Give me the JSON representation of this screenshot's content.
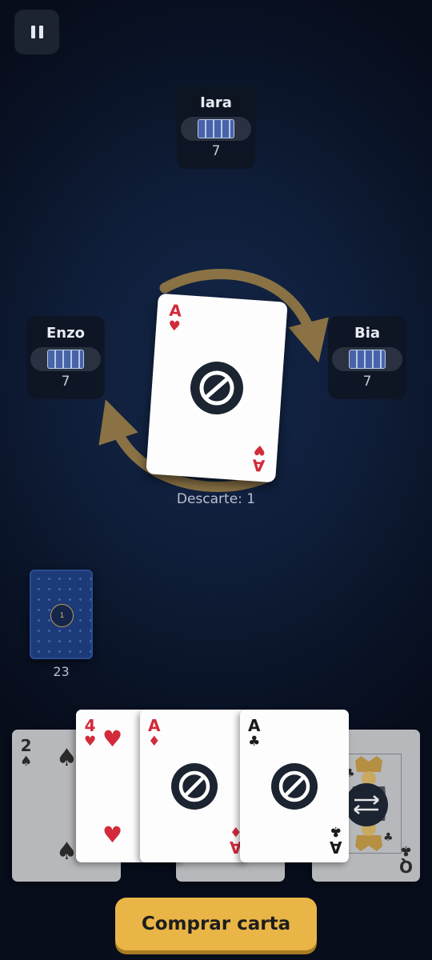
{
  "pause_icon": "pause-icon",
  "opponents": {
    "top": {
      "name": "Iara",
      "count": "7"
    },
    "left": {
      "name": "Enzo",
      "count": "7"
    },
    "right": {
      "name": "Bia",
      "count": "7"
    }
  },
  "direction_icon": "clockwise-arrows-icon",
  "discard": {
    "rank": "A",
    "suit": "♥",
    "action_icon": "skip-icon",
    "label": "Descarte: 1"
  },
  "deck": {
    "badge": "1",
    "count": "23"
  },
  "hand": [
    {
      "rank": "2",
      "suit": "♠"
    },
    {
      "rank": "4",
      "suit": "♥"
    },
    {
      "rank": "A",
      "suit": "♦",
      "action_icon": "skip-icon"
    },
    {
      "rank": "A",
      "suit": "♣",
      "action_icon": "skip-icon"
    },
    {
      "rank": "Q",
      "suit": "♣",
      "action_icon": "reverse-icon"
    }
  ],
  "draw_button": "Comprar carta",
  "colors": {
    "background": "#0f1d38",
    "button": "#e9b546",
    "arrows": "#8a7245",
    "red_suit": "#d12b3c"
  }
}
